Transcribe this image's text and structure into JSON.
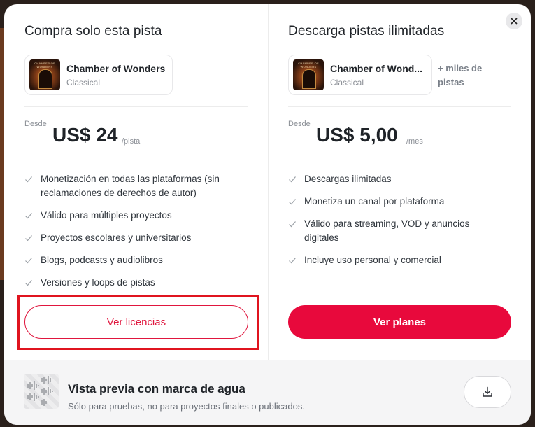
{
  "left": {
    "title": "Compra solo esta pista",
    "track": {
      "cover_text": "CHAMBER OF WONDERS",
      "title": "Chamber of Wonders",
      "genre": "Classical"
    },
    "price": {
      "from": "Desde",
      "amount": "US$ 24",
      "unit": "/pista"
    },
    "features": [
      "Monetización en todas las plataformas (sin reclamaciones de derechos de autor)",
      "Válido para múltiples proyectos",
      "Proyectos escolares y universitarios",
      "Blogs, podcasts y audiolibros",
      "Versiones y loops de pistas"
    ],
    "button": "Ver licencias"
  },
  "right": {
    "title": "Descarga pistas ilimitadas",
    "track": {
      "cover_text": "CHAMBER OF WONDERS",
      "title": "Chamber of Wond...",
      "genre": "Classical"
    },
    "more": "+ miles de pistas",
    "price": {
      "from": "Desde",
      "amount": "US$ 5,00",
      "unit": "/mes"
    },
    "features": [
      "Descargas ilimitadas",
      "Monetiza un canal por plataforma",
      "Válido para streaming, VOD y anuncios digitales",
      "Incluye uso personal y comercial"
    ],
    "button": "Ver planes"
  },
  "footer": {
    "title": "Vista previa con marca de agua",
    "subtitle": "Sólo para pruebas, no para proyectos finales o publicados."
  },
  "colors": {
    "accent": "#e8093c",
    "highlight": "#e0141f"
  },
  "icons": {
    "close": "close-icon",
    "check": "check-icon",
    "download": "download-icon",
    "waveform": "waveform-icon"
  }
}
